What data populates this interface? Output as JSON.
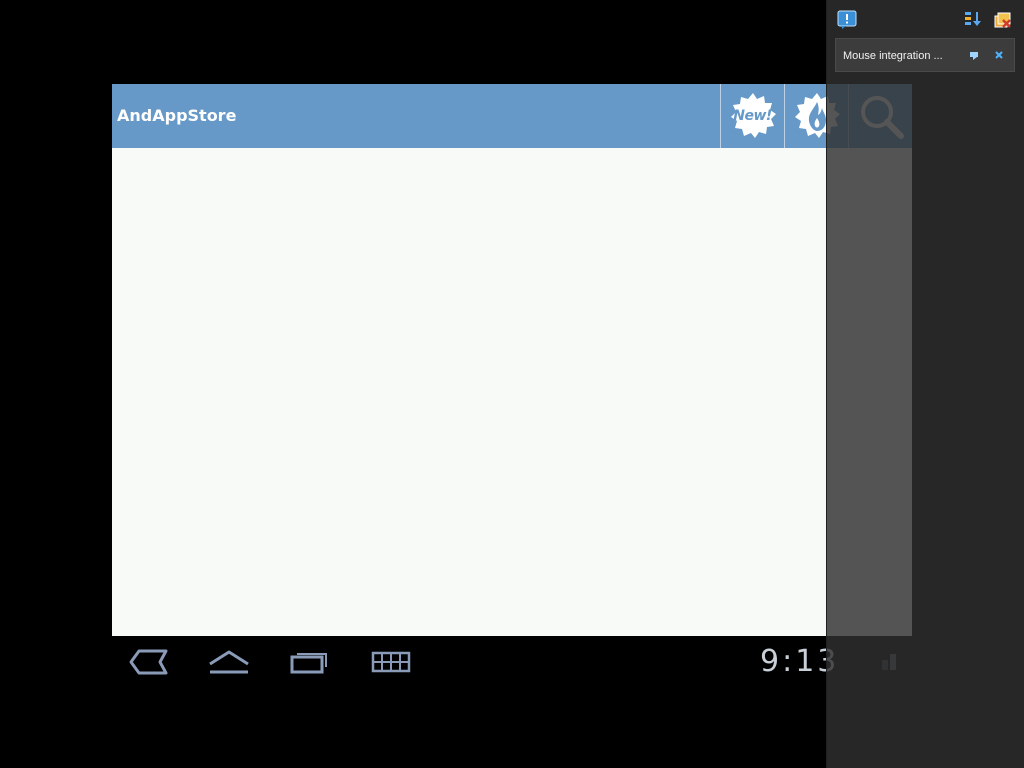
{
  "app": {
    "title": "AndAppStore",
    "actions": [
      {
        "name": "new",
        "icon": "new-badge-icon",
        "label": "New!"
      },
      {
        "name": "hot",
        "icon": "flame-badge-icon"
      },
      {
        "name": "search",
        "icon": "search-icon"
      }
    ],
    "colors": {
      "actionbar": "#6699c8",
      "content_bg": "#f7faf7"
    }
  },
  "system_bar": {
    "buttons": [
      {
        "name": "back",
        "icon": "back-icon"
      },
      {
        "name": "home",
        "icon": "home-icon"
      },
      {
        "name": "recent-apps",
        "icon": "recent-apps-icon"
      },
      {
        "name": "menu",
        "icon": "menu-icon"
      }
    ],
    "clock": "9:13"
  },
  "notification_panel": {
    "toolbar_icons": [
      "notification-info-icon",
      "sort-icon",
      "clear-all-icon"
    ],
    "notification": {
      "text": "Mouse integration ..."
    }
  }
}
